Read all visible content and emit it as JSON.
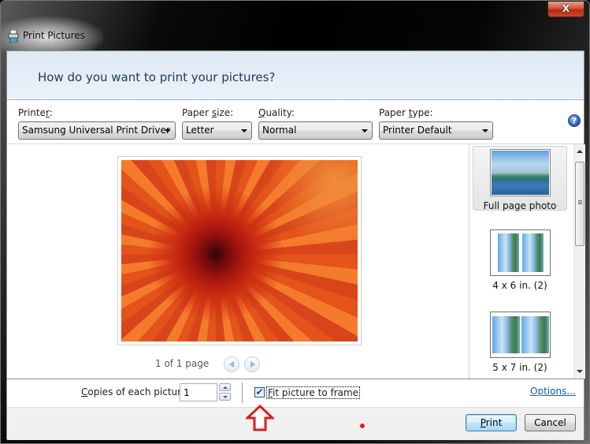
{
  "window": {
    "title": "Print Pictures",
    "close_label": "X"
  },
  "header": {
    "title": "How do you want to print your pictures?"
  },
  "options": {
    "printer": {
      "label_pre": "Printe",
      "label_accel": "r",
      "label_post": ":",
      "value": "Samsung Universal Print Driver"
    },
    "paper_size": {
      "label_pre": "Paper ",
      "label_accel": "s",
      "label_post": "ize:",
      "value": "Letter"
    },
    "quality": {
      "label_pre": "",
      "label_accel": "Q",
      "label_post": "uality:",
      "value": "Normal"
    },
    "paper_type": {
      "label_pre": "Paper ",
      "label_accel": "t",
      "label_post": "ype:",
      "value": "Printer Default"
    },
    "help_label": "?"
  },
  "preview": {
    "image_desc": "Orange chrysanthemum flower photo",
    "page_info": "1 of 1 page"
  },
  "layouts": [
    {
      "label": "Full page photo",
      "selected": true
    },
    {
      "label": "4 x 6 in. (2)",
      "selected": false
    },
    {
      "label": "5 x 7 in. (2)",
      "selected": false
    }
  ],
  "copies": {
    "label_accel": "C",
    "label_rest": "opies of each picture:",
    "value": "1"
  },
  "fit": {
    "checked": true,
    "check_glyph": "✔",
    "label_accel": "F",
    "label_rest": "it picture to frame"
  },
  "links": {
    "options": "Options..."
  },
  "buttons": {
    "print_accel": "P",
    "print_rest": "rint",
    "cancel": "Cancel"
  },
  "colors": {
    "header_text": "#1e3957",
    "link": "#0b5fb3",
    "annotation_red": "#d62020"
  }
}
